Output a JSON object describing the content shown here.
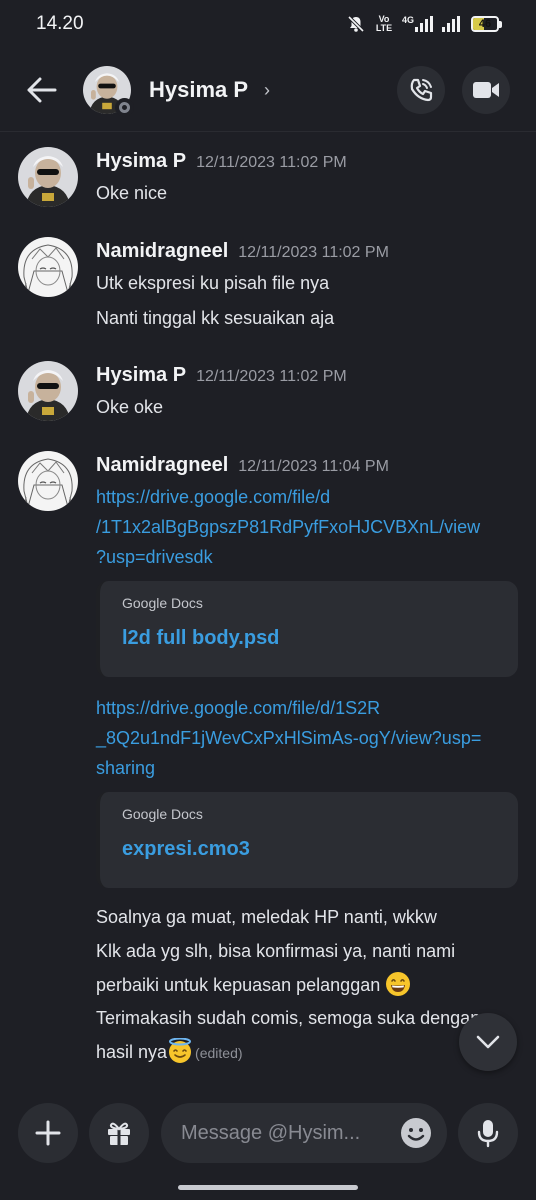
{
  "status_bar": {
    "time": "14.20",
    "volte": "Vo LTE",
    "network": "4G",
    "battery": "46",
    "battery_level": 0.46
  },
  "header": {
    "contact_name": "Hysima P",
    "chevron": "›",
    "icons": {
      "back": "arrow-left-icon",
      "call": "phone-call-icon",
      "video": "video-camera-icon"
    }
  },
  "messages": [
    {
      "author": "Hysima P",
      "timestamp": "12/11/2023 11:02 PM",
      "lines": [
        "Oke nice"
      ]
    },
    {
      "author": "Namidragneel",
      "timestamp": "12/11/2023 11:02 PM",
      "lines": [
        "Utk ekspresi ku pisah file nya",
        "Nanti tinggal kk sesuaikan aja"
      ]
    },
    {
      "author": "Hysima P",
      "timestamp": "12/11/2023 11:02 PM",
      "lines": [
        "Oke oke"
      ]
    },
    {
      "author": "Namidragneel",
      "timestamp": "12/11/2023 11:04 PM",
      "link1": [
        "https://drive.google.com/file/d",
        "/1T1x2alBgBgpszP81RdPyfFxoHJCVBXnL/view",
        "?usp=drivesdk"
      ],
      "embed1": {
        "provider": "Google Docs",
        "title": "l2d full body.psd"
      },
      "link2": [
        "https://drive.google.com/file/d/1S2R",
        "_8Q2u1ndF1jWevCxPxHlSimAs-ogY/view?usp=",
        "sharing"
      ],
      "embed2": {
        "provider": "Google Docs",
        "title": "expresi.cmo3"
      },
      "lines": [
        "Soalnya ga muat, meledak HP nanti, wkkw",
        "Klk ada yg slh, bisa konfirmasi ya, nanti nami",
        "perbaiki untuk kepuasan pelanggan",
        "Terimakasih sudah comis, semoga suka dengan",
        "hasil nya"
      ],
      "edited": "(edited)"
    }
  ],
  "composer": {
    "placeholder": "Message @Hysim...",
    "icons": {
      "plus": "plus-icon",
      "gift": "gift-icon",
      "emoji": "emoji-icon",
      "mic": "microphone-icon"
    }
  },
  "colors": {
    "background": "#1e1f25",
    "surface": "#2b2d33",
    "link": "#3a9de0",
    "text": "#e2e4e9",
    "muted": "#9a9ca4"
  }
}
